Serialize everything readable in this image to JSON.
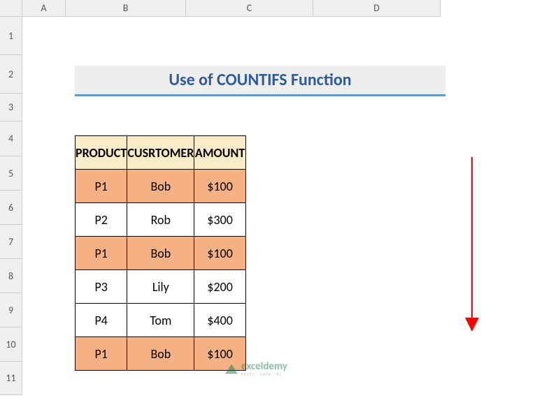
{
  "columns": [
    "A",
    "B",
    "C",
    "D"
  ],
  "rows": [
    "1",
    "2",
    "3",
    "4",
    "5",
    "6",
    "7",
    "8",
    "9",
    "10",
    "11"
  ],
  "title": "Use of COUNTIFS Function",
  "headers": {
    "product": "PRODUCT",
    "customer": "CUSRTOMER",
    "amount": "AMOUNT"
  },
  "currency": "$",
  "data": [
    {
      "product": "P1",
      "customer": "Bob",
      "amount": "100",
      "highlight": true
    },
    {
      "product": "P2",
      "customer": "Rob",
      "amount": "300",
      "highlight": false
    },
    {
      "product": "P1",
      "customer": "Bob",
      "amount": "100",
      "highlight": true
    },
    {
      "product": "P3",
      "customer": "Lily",
      "amount": "200",
      "highlight": false
    },
    {
      "product": "P4",
      "customer": "Tom",
      "amount": "400",
      "highlight": false
    },
    {
      "product": "P1",
      "customer": "Bob",
      "amount": "100",
      "highlight": true
    }
  ],
  "watermark": {
    "main": "exceldemy",
    "sub": "EXCEL · DATA · BI"
  },
  "chart_data": {
    "type": "table",
    "title": "Use of COUNTIFS Function",
    "columns": [
      "PRODUCT",
      "CUSRTOMER",
      "AMOUNT"
    ],
    "rows": [
      [
        "P1",
        "Bob",
        100
      ],
      [
        "P2",
        "Rob",
        300
      ],
      [
        "P1",
        "Bob",
        100
      ],
      [
        "P3",
        "Lily",
        200
      ],
      [
        "P4",
        "Tom",
        400
      ],
      [
        "P1",
        "Bob",
        100
      ]
    ]
  }
}
